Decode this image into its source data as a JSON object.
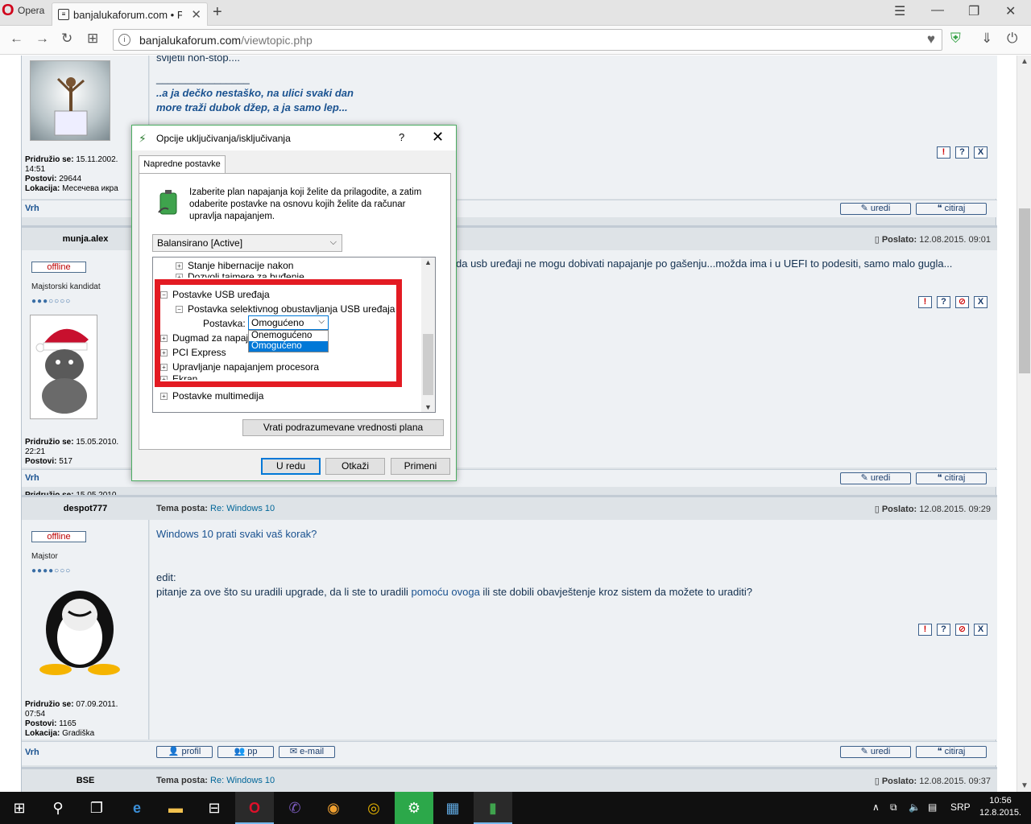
{
  "browser": {
    "app_name": "Opera",
    "tab_title": "banjalukaforum.com • Pog",
    "url_host": "banjalukaforum.com",
    "url_path": "/viewtopic.php"
  },
  "post1": {
    "quote_top": "svijetli non-stop....",
    "signature_line": "________________",
    "sig1": "..a ja dečko nestaško, na ulici svaki dan",
    "sig2": "more traži dubok džep, a ja samo lep...",
    "joined_label": "Pridružio se:",
    "joined": "15.11.2002.",
    "joined_time": "14:51",
    "posts_label": "Postovi:",
    "posts": "29644",
    "loc_label": "Lokacija:",
    "location": "Месечева икра"
  },
  "post2": {
    "username": "munja.alex",
    "status": "offline",
    "rank": "Majstorski kandidat",
    "rank_dots": "●●●○○○○",
    "posted_label": "Poslato:",
    "posted": "12.08.2015. 09:01",
    "text": "da usb uređaji ne mogu dobivati napajanje po gašenju...možda ima i u UEFI to podesiti, samo malo gugla...",
    "joined_label": "Pridružio se:",
    "joined": "15.05.2010.",
    "joined_time": "22:21",
    "posts_label": "Postovi:",
    "posts": "517"
  },
  "post3": {
    "username": "despot777",
    "status": "offline",
    "rank": "Majstor",
    "rank_dots": "●●●●○○○",
    "topic_label": "Tema posta:",
    "topic": "Re: Windows 10",
    "posted_label": "Poslato:",
    "posted": "12.08.2015. 09:29",
    "line1": "Windows 10 prati svaki vaš korak?",
    "line2": "edit:",
    "line3a": "pitanje za ove što su uradili upgrade, da li ste to uradili ",
    "link": "pomoću ovoga",
    "line3b": " ili ste dobili obavještenje kroz sistem da možete to uraditi?",
    "joined_label": "Pridružio se:",
    "joined": "07.09.2011.",
    "joined_time": "07:54",
    "posts_label": "Postovi:",
    "posts": "1165",
    "loc_label": "Lokacija:",
    "location": "Gradiška"
  },
  "post4": {
    "username": "BSE",
    "topic_label": "Tema posta:",
    "topic": "Re: Windows 10",
    "posted_label": "Poslato:",
    "posted": "12.08.2015. 09:37"
  },
  "buttons": {
    "top": "Vrh",
    "edit": "uredi",
    "quote": "citiraj",
    "profile": "profil",
    "pm": "pp",
    "email": "e-mail"
  },
  "dialog": {
    "title": "Opcije uključivanja/isključivanja",
    "help": "?",
    "tab": "Napredne postavke",
    "description": "Izaberite plan napajanja koji želite da prilagodite, a zatim odaberite postavke na osnovu kojih želite da računar upravlja napajanjem.",
    "plan": "Balansirano [Active]",
    "tree": {
      "hibernate": "Stanje hibernacije nakon",
      "wake_timers": "Dozvoli tajmere za buđenje",
      "usb": "Postavke USB uređaja",
      "usb_selective": "Postavka selektivnog obustavljanja USB uređaja",
      "setting_label": "Postavka:",
      "setting_value": "Omogućeno",
      "power_buttons": "Dugmad za napajanje",
      "pci": "PCI Express",
      "cpu": "Upravljanje napajanjem procesora",
      "screen": "Ekran",
      "multimedia": "Postavke multimedija"
    },
    "options": [
      "Onemogućeno",
      "Omogućeno"
    ],
    "restore": "Vrati podrazumevane vrednosti plana",
    "ok": "U redu",
    "cancel": "Otkaži",
    "apply": "Primeni"
  },
  "taskbar": {
    "language": "SRP",
    "time": "10:56",
    "date": "12.8.2015."
  }
}
